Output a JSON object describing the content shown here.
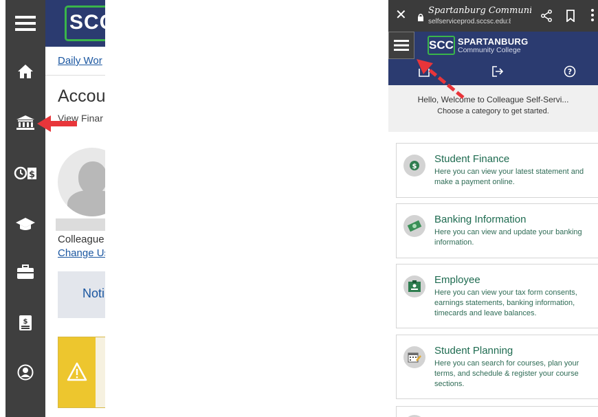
{
  "left_panel": {
    "logo_text": "SCC",
    "breadcrumb": "Daily Wor",
    "page_title": "Accou",
    "page_subtitle": "View Finar",
    "user_name": "Colleague",
    "change_user_link": "Change Us",
    "notification_label": "Noti",
    "rail_icons": [
      "menu-icon",
      "home-icon",
      "bank-icon",
      "timecard-icon",
      "graduation-cap-icon",
      "briefcase-icon",
      "tax-form-icon",
      "user-circle-icon"
    ]
  },
  "right_panel": {
    "browser": {
      "tab_title": "Spartanburg Communit...",
      "url": "selfserviceprod.sccsc.edu:8172"
    },
    "header": {
      "logo_text": "SCC",
      "college_name": "SPARTANBURG",
      "college_sub": "Community College"
    },
    "welcome": {
      "line1": "Hello, Welcome to Colleague Self-Servi...",
      "line2": "Choose a category to get started."
    },
    "cards": [
      {
        "title": "Student Finance",
        "description": "Here you can view your latest statement and make a payment online.",
        "icon": "dollar-coin-icon"
      },
      {
        "title": "Banking Information",
        "description": "Here you can view and update your banking information.",
        "icon": "money-icon"
      },
      {
        "title": "Employee",
        "description": "Here you can view your tax form consents, earnings statements, banking information, timecards and leave balances.",
        "icon": "employee-badge-icon"
      },
      {
        "title": "Student Planning",
        "description": "Here you can search for courses, plan your terms, and schedule & register your course sections.",
        "icon": "calendar-planning-icon"
      }
    ]
  },
  "colors": {
    "header_navy": "#2b3b70",
    "rail_gray": "#3f3f3f",
    "logo_green": "#3ab54a",
    "card_text_green": "#1e6b50",
    "link_blue": "#1a56a0",
    "arrow_red": "#e8353a"
  }
}
